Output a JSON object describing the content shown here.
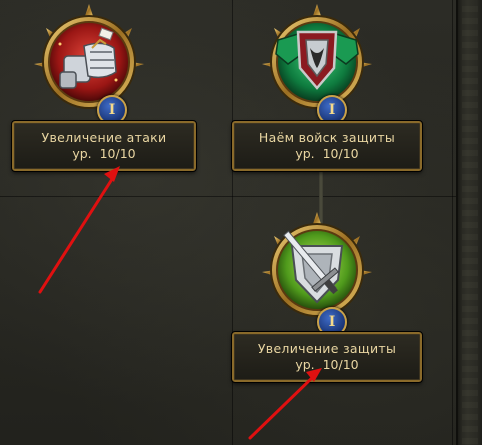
{
  "skills": [
    {
      "name": "Увеличение атаки",
      "level_prefix": "ур.",
      "level": "10/10",
      "tier": "I",
      "icon": "gauntlet-fist-icon"
    },
    {
      "name": "Наём войск защиты",
      "level_prefix": "ур.",
      "level": "10/10",
      "tier": "I",
      "icon": "green-shields-icon"
    },
    {
      "name": "Увеличение защиты",
      "level_prefix": "ур.",
      "level": "10/10",
      "tier": "I",
      "icon": "shield-sword-icon"
    }
  ],
  "colors": {
    "label_text": "#e9d6a2",
    "label_border": "#8a6a2a",
    "badge_blue": "#1a3576",
    "arrow_red": "#e01010"
  }
}
